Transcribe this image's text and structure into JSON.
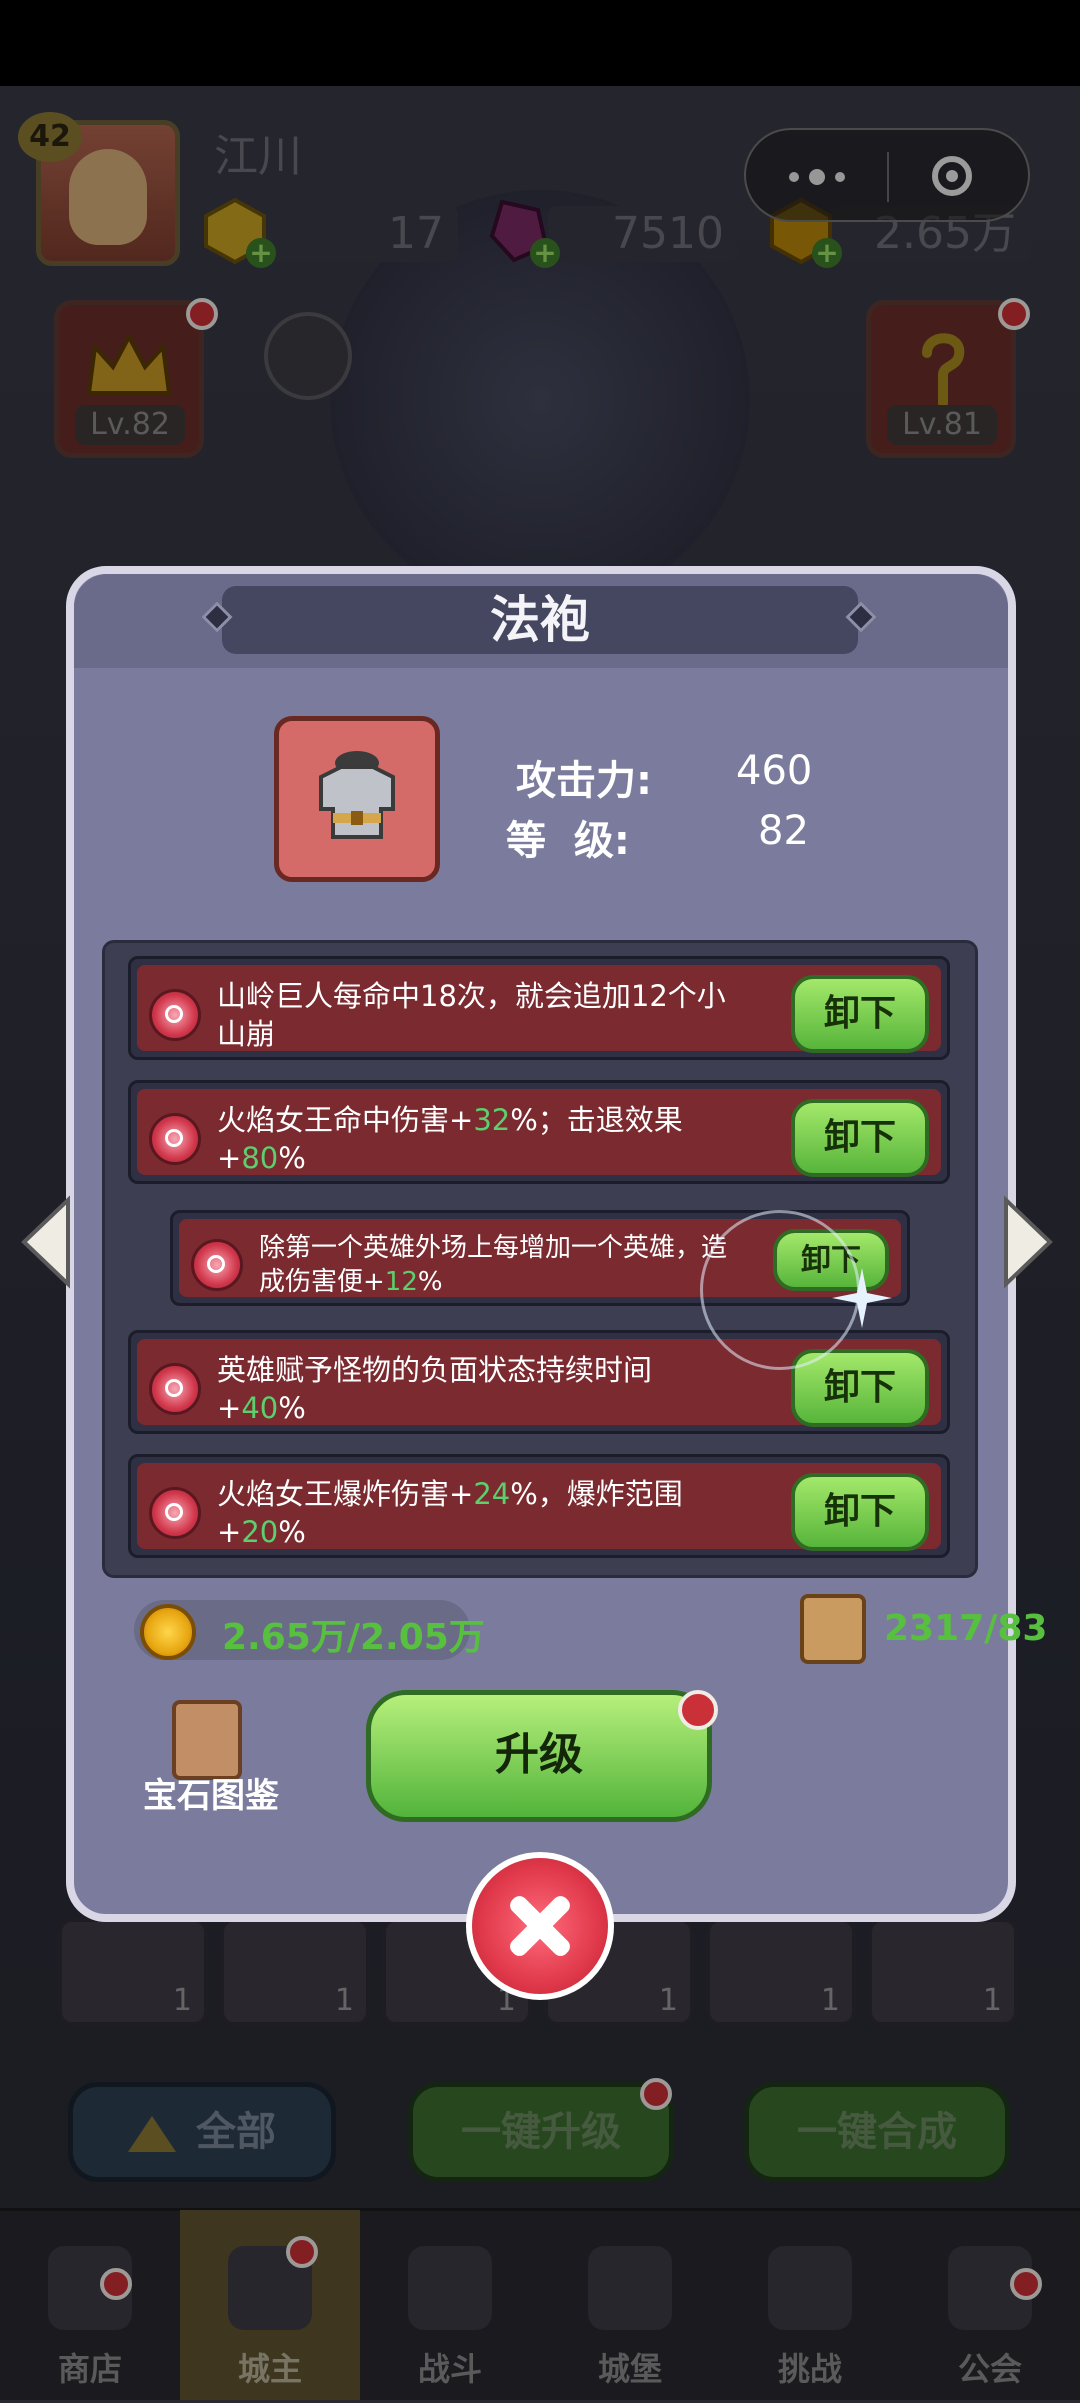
{
  "header": {
    "level": "42",
    "username": "江川",
    "resources": [
      {
        "icon": "gold-gem-icon",
        "value": "17"
      },
      {
        "icon": "purple-crystal-icon",
        "value": "7510"
      },
      {
        "icon": "gold-coin-icon",
        "value": "2.65万"
      }
    ],
    "side_left": {
      "level": "Lv.82"
    },
    "side_right": {
      "level": "Lv.81"
    }
  },
  "modal": {
    "title": "法袍",
    "stats": [
      {
        "label": "攻击力:",
        "value": "460"
      },
      {
        "label": "等  级:",
        "value": "82"
      }
    ],
    "gems": [
      {
        "parts": [
          {
            "t": "山岭巨人每命中18次，就会追加12个小山崩",
            "g": false
          }
        ],
        "button": "卸下"
      },
      {
        "parts": [
          {
            "t": "火焰女王命中伤害+",
            "g": false
          },
          {
            "t": "32",
            "g": true
          },
          {
            "t": "%；击退效果+",
            "g": false
          },
          {
            "t": "80",
            "g": true
          },
          {
            "t": "%",
            "g": false
          }
        ],
        "button": "卸下"
      },
      {
        "parts": [
          {
            "t": "除第一个英雄外场上每增加一个英雄，造成伤害便+",
            "g": false
          },
          {
            "t": "12",
            "g": true
          },
          {
            "t": "%",
            "g": false
          }
        ],
        "button": "卸下"
      },
      {
        "parts": [
          {
            "t": "英雄赋予怪物的负面状态持续时间+",
            "g": false
          },
          {
            "t": "40",
            "g": true
          },
          {
            "t": "%",
            "g": false
          }
        ],
        "button": "卸下"
      },
      {
        "parts": [
          {
            "t": "火焰女王爆炸伤害+",
            "g": false
          },
          {
            "t": "24",
            "g": true
          },
          {
            "t": "%，爆炸范围+",
            "g": false
          },
          {
            "t": "20",
            "g": true
          },
          {
            "t": "%",
            "g": false
          }
        ],
        "button": "卸下"
      }
    ],
    "cost_coins": "2.65万/2.05万",
    "cost_scrolls": "2317/83",
    "codex_label": "宝石图鉴",
    "upgrade_label": "升级"
  },
  "bottom_slots": [
    "1",
    "1",
    "1",
    "1",
    "1",
    "1"
  ],
  "bottom_buttons": {
    "all": "全部",
    "one_click_upgrade": "一键升级",
    "one_click_merge": "一键合成"
  },
  "tabs": [
    {
      "label": "商店",
      "icon": "shop-icon"
    },
    {
      "label": "城主",
      "icon": "lord-icon",
      "active": true
    },
    {
      "label": "战斗",
      "icon": "swords-icon"
    },
    {
      "label": "城堡",
      "icon": "castle-icon"
    },
    {
      "label": "挑战",
      "icon": "challenge-icon"
    },
    {
      "label": "公会",
      "icon": "guild-icon"
    }
  ],
  "colors": {
    "accent_green": "#5bd06c",
    "button_green": "#57b53b",
    "modal": "#7b7c9d",
    "row_red": "#7b2a30"
  }
}
